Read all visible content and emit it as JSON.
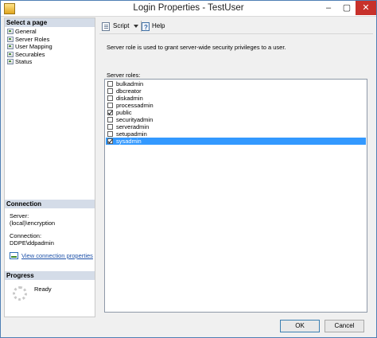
{
  "window": {
    "title": "Login Properties - TestUser",
    "controls": {
      "minimize": "–",
      "maximize": "▢",
      "close": "✕"
    }
  },
  "left_pane": {
    "select_page_header": "Select a page",
    "pages": [
      {
        "label": "General",
        "icon": "page-icon"
      },
      {
        "label": "Server Roles",
        "icon": "page-icon"
      },
      {
        "label": "User Mapping",
        "icon": "page-icon"
      },
      {
        "label": "Securables",
        "icon": "page-icon"
      },
      {
        "label": "Status",
        "icon": "page-icon"
      }
    ],
    "connection": {
      "header": "Connection",
      "server_label": "Server:",
      "server_value": "(local)\\encryption",
      "connection_label": "Connection:",
      "connection_value": "DDPE\\ddpadmin",
      "link_text": "View connection properties"
    },
    "progress": {
      "header": "Progress",
      "status": "Ready"
    }
  },
  "toolbar": {
    "script_label": "Script",
    "help_label": "Help"
  },
  "main": {
    "description": "Server role is used to grant server-wide security privileges to a user.",
    "roles_label": "Server roles:",
    "roles": [
      {
        "name": "bulkadmin",
        "checked": false,
        "selected": false
      },
      {
        "name": "dbcreator",
        "checked": false,
        "selected": false
      },
      {
        "name": "diskadmin",
        "checked": false,
        "selected": false
      },
      {
        "name": "processadmin",
        "checked": false,
        "selected": false
      },
      {
        "name": "public",
        "checked": true,
        "selected": false
      },
      {
        "name": "securityadmin",
        "checked": false,
        "selected": false
      },
      {
        "name": "serveradmin",
        "checked": false,
        "selected": false
      },
      {
        "name": "setupadmin",
        "checked": false,
        "selected": false
      },
      {
        "name": "sysadmin",
        "checked": true,
        "selected": true
      }
    ]
  },
  "footer": {
    "ok_label": "OK",
    "cancel_label": "Cancel"
  },
  "colors": {
    "selection": "#3399ff",
    "section_header": "#d4dce8",
    "link": "#1c50a8",
    "close_button": "#c7312b"
  }
}
